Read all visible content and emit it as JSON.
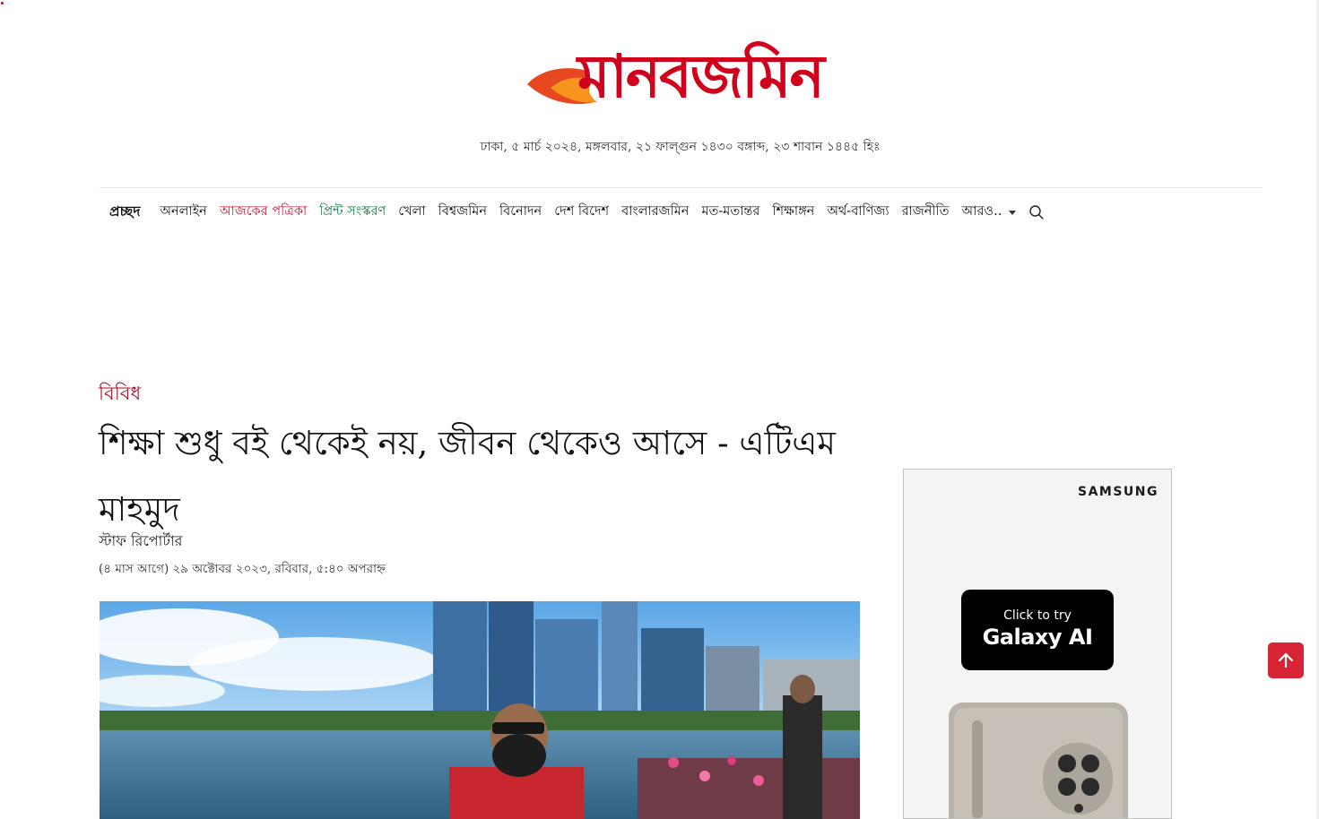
{
  "site": {
    "logo_text": "মানবজমিন",
    "dateline": "ঢাকা, ৫ মার্চ ২০২৪, মঙ্গলবার, ২১ ফাল্গুন ১৪৩০ বঙ্গাব্দ, ২৩ শাবান ১৪৪৫ হিঃ"
  },
  "nav": {
    "home": "প্রচ্ছদ",
    "items": [
      "অনলাইন",
      "আজকের পত্রিকা",
      "প্রিন্ট সংস্করণ",
      "খেলা",
      "বিশ্বজমিন",
      "বিনোদন",
      "দেশ বিদেশ",
      "বাংলারজমিন",
      "মত-মতান্তর",
      "শিক্ষাঙ্গন",
      "অর্থ-বাণিজ্য",
      "রাজনীতি"
    ],
    "more": "আরও..",
    "search_icon": "search-icon"
  },
  "article": {
    "category": "বিবিধ",
    "headline": "শিক্ষা শুধু বই থেকেই নয়, জীবন থেকেও আসে - এটিএম মাহমুদ",
    "author": "স্টাফ রিপোর্টার",
    "timestamp": "(৪ মাস আগে) ২৯ অক্টোবর ২০২৩, রবিবার, ৫:৪০ অপরাহ্ন"
  },
  "ad": {
    "brand": "SAMSUNG",
    "cta_line1": "Click to try",
    "cta_line2": "Galaxy AI"
  },
  "colors": {
    "brand_red": "#d0021b",
    "category_red": "#a50e24",
    "link_green": "#0a7a3c",
    "back_to_top": "#d72436"
  }
}
